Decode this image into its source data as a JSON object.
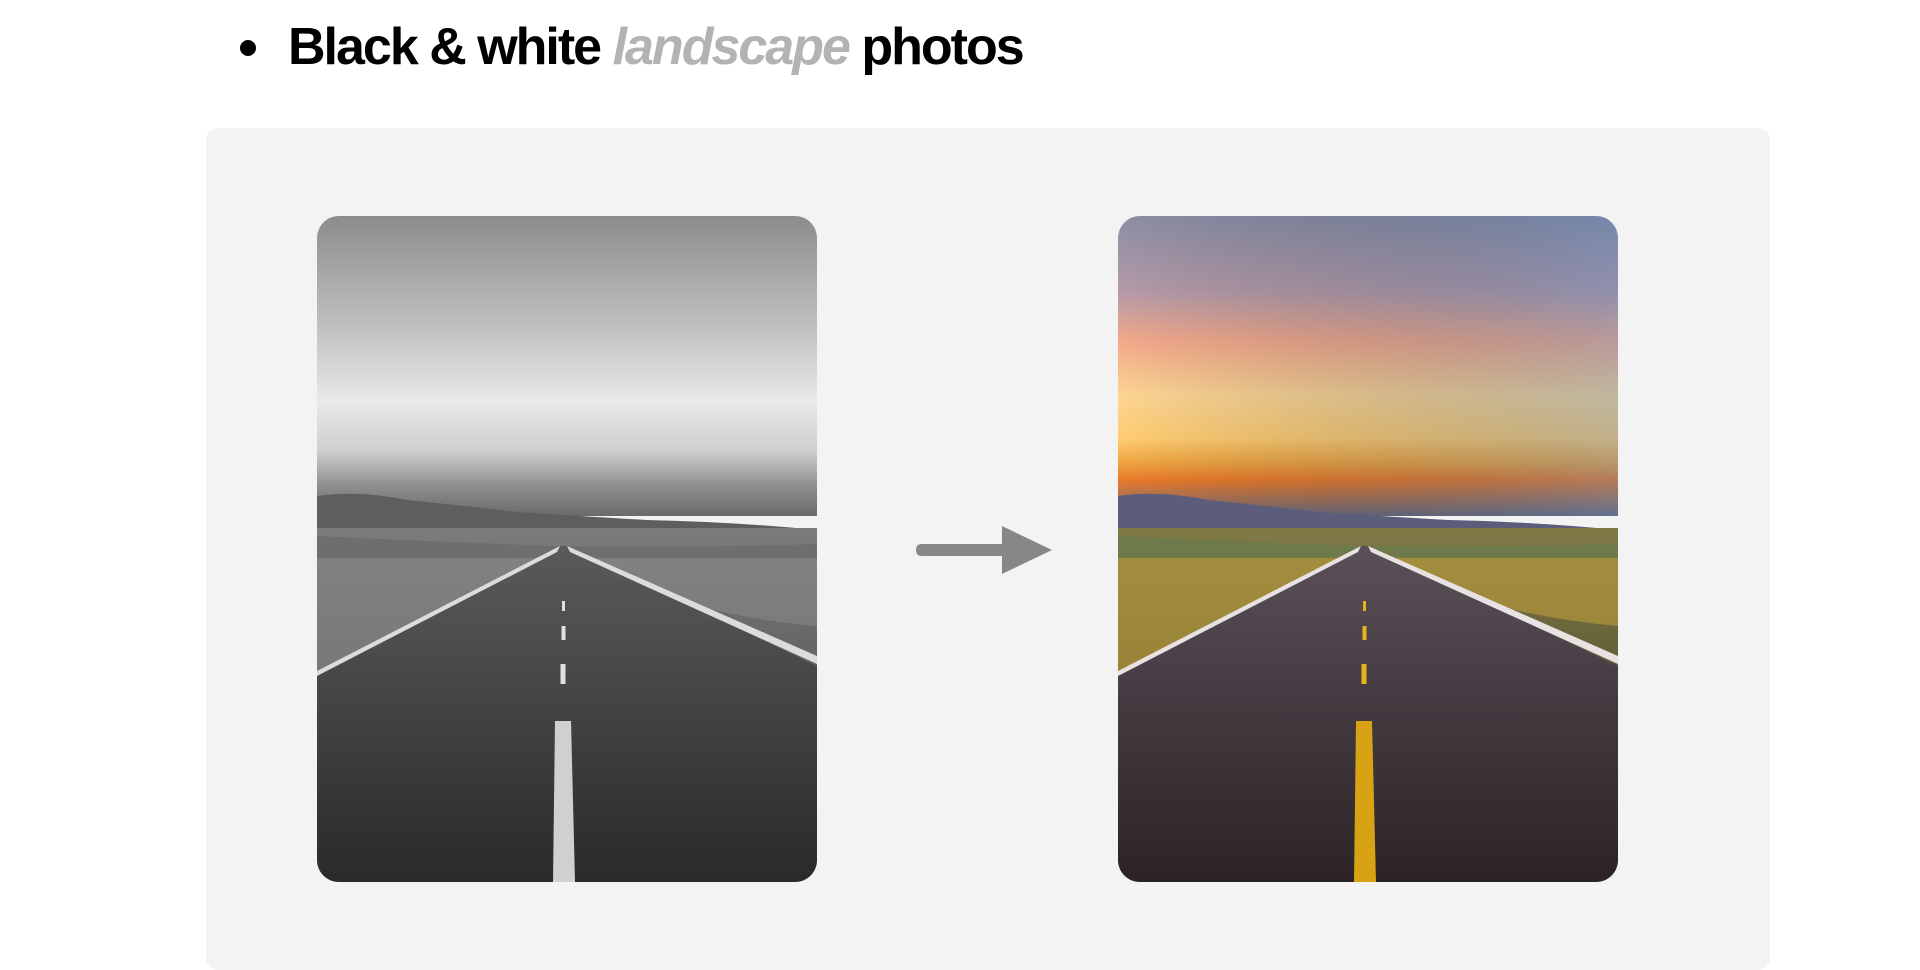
{
  "heading": {
    "part1": "Black & white",
    "part2": "landscape",
    "part3": "photos"
  },
  "colors": {
    "muted_word": "#b3b3b3",
    "panel_bg": "#f3f3f3",
    "arrow": "#878787"
  },
  "icons": {
    "arrow": "arrow-right-icon"
  }
}
